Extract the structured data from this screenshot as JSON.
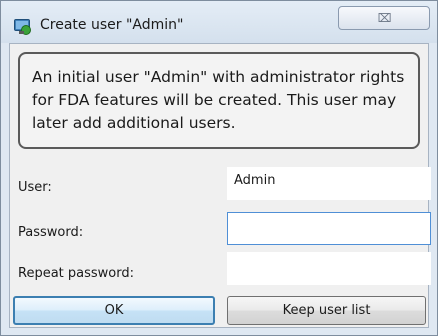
{
  "window": {
    "title": "Create user \"Admin\"",
    "close_glyph": "⌧"
  },
  "info": {
    "message": "An initial user \"Admin\" with administrator rights for FDA features will be created. This user may later add additional users."
  },
  "form": {
    "user_label": "User:",
    "user_value": "Admin",
    "password_label": "Password:",
    "password_value": "",
    "repeat_password_label": "Repeat password:",
    "repeat_password_value": ""
  },
  "buttons": {
    "ok": "OK",
    "keep": "Keep user list"
  },
  "colors": {
    "accent": "#3c7fb1",
    "focus_border": "#4f8fd6",
    "window_frame": "#dfe8f2"
  }
}
